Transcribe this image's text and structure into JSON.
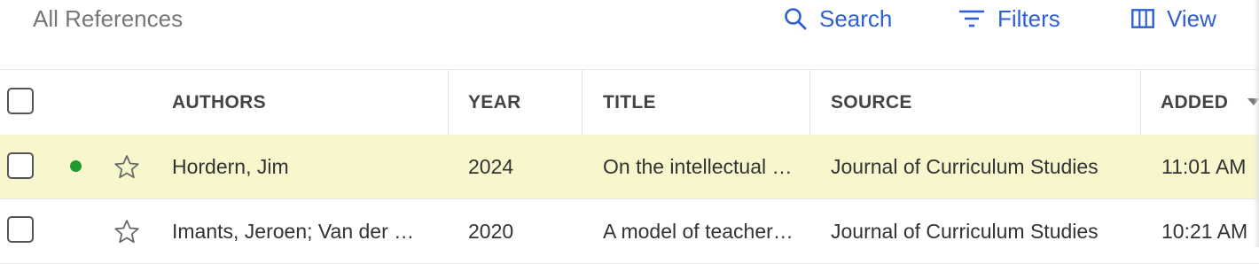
{
  "toolbar": {
    "title": "All References",
    "search_label": "Search",
    "filters_label": "Filters",
    "view_label": "View",
    "accent_color": "#2f5fd1"
  },
  "table": {
    "columns": {
      "authors": "AUTHORS",
      "year": "YEAR",
      "title": "TITLE",
      "source": "SOURCE",
      "added": "ADDED"
    },
    "sort": {
      "column": "ADDED",
      "direction": "descending",
      "icon": "sort-down-icon"
    },
    "rows": [
      {
        "authors": "Hordern, Jim",
        "year": "2024",
        "title": "On the intellectual …",
        "source": "Journal of Curriculum Studies",
        "added": "11:01 AM",
        "unread": true,
        "starred": false,
        "highlighted": true
      },
      {
        "authors": "Imants, Jeroen; Van der …",
        "year": "2020",
        "title": "A model of teacher…",
        "source": "Journal of Curriculum Studies",
        "added": "10:21 AM",
        "unread": false,
        "starred": false,
        "highlighted": false
      }
    ]
  },
  "colors": {
    "highlight_row": "#f8f6cc",
    "unread_dot": "#1e9a2e"
  }
}
